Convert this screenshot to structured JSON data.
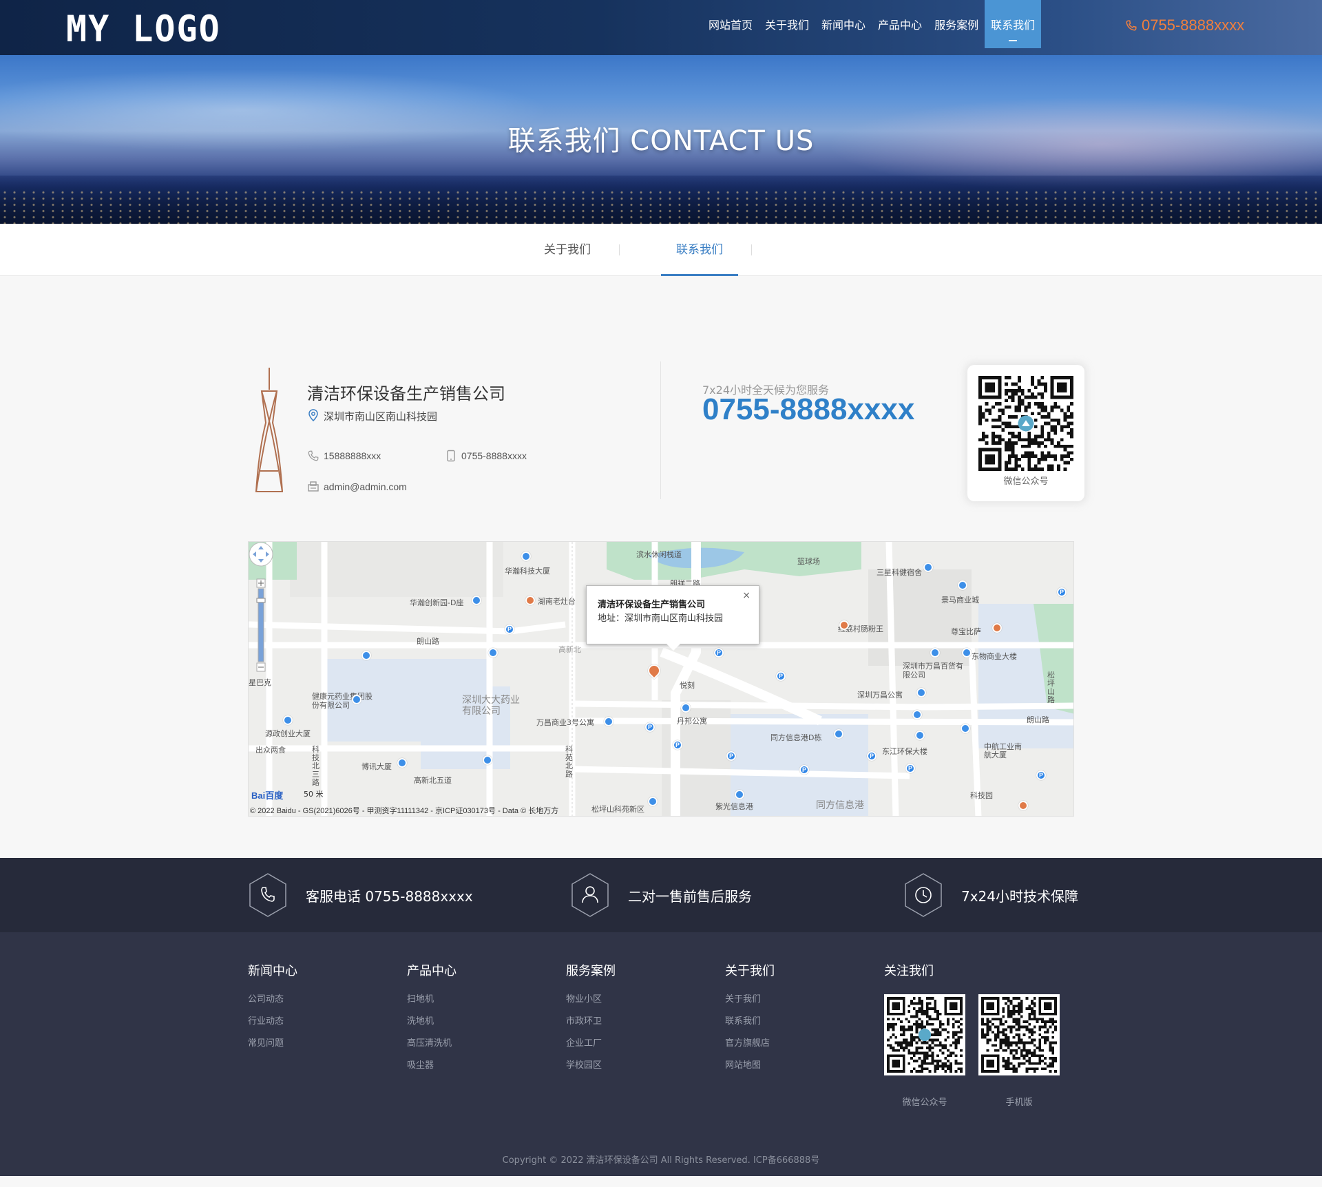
{
  "header": {
    "logo": "MY LOGO",
    "nav": [
      "网站首页",
      "关于我们",
      "新闻中心",
      "产品中心",
      "服务案例",
      "联系我们"
    ],
    "active_nav": "联系我们",
    "phone": "0755-8888xxxx"
  },
  "banner": {
    "title": "联系我们  CONTACT US"
  },
  "subnav": {
    "tabs": [
      "关于我们",
      "联系我们"
    ],
    "active": "联系我们"
  },
  "contact": {
    "company": "清洁环保设备生产销售公司",
    "address": "深圳市南山区南山科技园",
    "mobile": "15888888xxx",
    "tel": "0755-8888xxxx",
    "email": "admin@admin.com",
    "service_text": "7x24小时全天候为您服务",
    "hotline": "0755-8888xxxx",
    "qr_caption": "微信公众号"
  },
  "map": {
    "popup_title": "清洁环保设备生产销售公司",
    "popup_address": "地址：深圳市南山区南山科技园",
    "close": "×",
    "labels": [
      "华瀚科技大厦",
      "滨水休闲栈道",
      "篮球场",
      "三星科健宿舍",
      "景马商业城",
      "朗祥二路",
      "华瀚创新园-D座",
      "湖南老灶台",
      "红荔村肠粉王",
      "尊宝比萨",
      "朗山路",
      "高新北",
      "东物商业大楼",
      "深圳市万昌百货有限公司",
      "悦刻",
      "深圳万昌公寓",
      "健康元药业集团股份有限公司",
      "深圳大大药业有限公司",
      "万昌商业3号公寓",
      "丹邦公寓",
      "同方信息港D栋",
      "源政创业大厦",
      "出众两食",
      "东江环保大楼",
      "中航工业南航大厦",
      "博讯大厦",
      "高新北五道",
      "紫光信息港",
      "同方信息港",
      "科技园",
      "松坪山科苑新区",
      "科苑北路",
      "科技北三路",
      "朗山路",
      "星巴克",
      "松坪山路"
    ],
    "scale": "50 米",
    "baidu": "Bai百度",
    "copyright": "© 2022 Baidu - GS(2021)6026号 - 甲测资字11111342 - 京ICP证030173号 - Data © 长地万方"
  },
  "footer": {
    "features": [
      "客服电话 0755-8888xxxx",
      "二对一售前售后服务",
      "7x24小时技术保障"
    ],
    "columns": [
      {
        "title": "新闻中心",
        "links": [
          "公司动态",
          "行业动态",
          "常见问题"
        ]
      },
      {
        "title": "产品中心",
        "links": [
          "扫地机",
          "洗地机",
          "高压清洗机",
          "吸尘器"
        ]
      },
      {
        "title": "服务案例",
        "links": [
          "物业小区",
          "市政环卫",
          "企业工厂",
          "学校园区"
        ]
      },
      {
        "title": "关于我们",
        "links": [
          "关于我们",
          "联系我们",
          "官方旗舰店",
          "网站地图"
        ]
      }
    ],
    "follow_title": "关注我们",
    "qr_captions": [
      "微信公众号",
      "手机版"
    ],
    "copyright": "Copyright © 2022 清洁环保设备公司 All Rights Reserved. ICP备666888号"
  },
  "colors": {
    "accent": "#3b7fc4",
    "phone_orange": "#f07f3d",
    "footer_dark": "#262a3a",
    "footer_bg": "#303447"
  },
  "icons": [
    "phone-icon",
    "location-icon",
    "mobile-icon",
    "email-icon",
    "tower-icon",
    "qr-code",
    "headset-icon",
    "user-icon",
    "clock-icon"
  ]
}
